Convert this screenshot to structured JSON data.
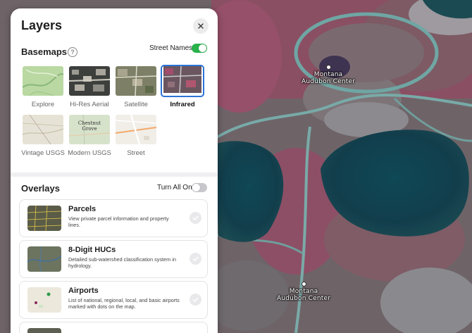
{
  "panel": {
    "title": "Layers",
    "close_icon": "close-icon"
  },
  "basemaps": {
    "title": "Basemaps",
    "help_icon": "question-icon",
    "street_names_label": "Street Names",
    "street_names_on": true,
    "selected": "Infrared",
    "items": [
      {
        "label": "Explore"
      },
      {
        "label": "Hi-Res Aerial"
      },
      {
        "label": "Satellite"
      },
      {
        "label": "Infrared"
      },
      {
        "label": "Vintage USGS"
      },
      {
        "label": "Modern USGS",
        "thumb_text": "Chestnut Grove"
      },
      {
        "label": "Street"
      }
    ]
  },
  "overlays": {
    "title": "Overlays",
    "turn_all_on_label": "Turn All On",
    "turn_all_on": false,
    "items": [
      {
        "title": "Parcels",
        "description": "View private parcel information and property lines."
      },
      {
        "title": "8-Digit HUCs",
        "description": "Detailed sub-watershed classification system in hydrology."
      },
      {
        "title": "Airports",
        "description": "List of national, regional, local, and basic airports marked with dots on the map."
      }
    ]
  },
  "map": {
    "labels": [
      {
        "line1": "Montana",
        "line2": "Audubon Center"
      },
      {
        "line1": "Montana",
        "line2": "Audubon Center"
      }
    ]
  },
  "colors": {
    "accent": "#2d73d6",
    "toggle_on": "#27b24a",
    "water": "#123e4c"
  }
}
